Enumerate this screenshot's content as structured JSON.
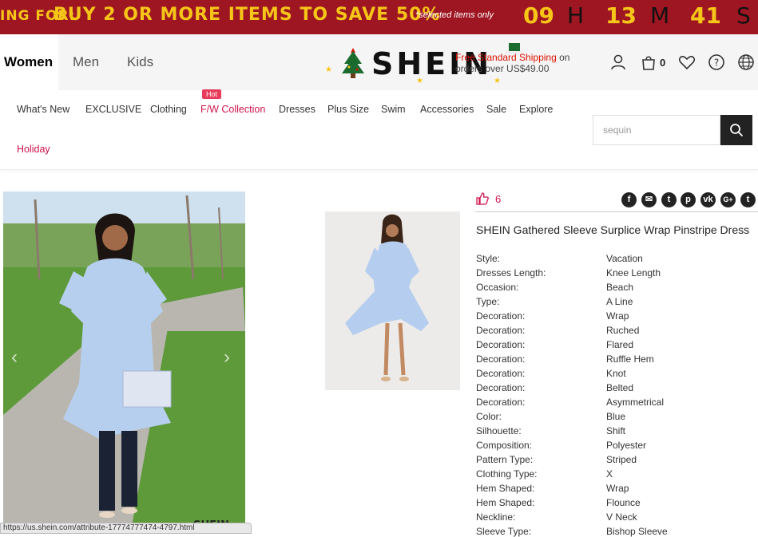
{
  "banner": {
    "lead": "ING FOR:",
    "promo": "BUY 2 OR MORE ITEMS TO SAVE",
    "percent": "50%",
    "note": "*selected items only",
    "hours": "09",
    "hours_unit": "H",
    "minutes": "13",
    "minutes_unit": "M",
    "seconds": "41",
    "seconds_unit": "S",
    "bg_color": "#9e1622",
    "text_color": "#f5c518"
  },
  "header": {
    "tabs": [
      {
        "label": "Women"
      },
      {
        "label": "Men"
      },
      {
        "label": "Kids"
      }
    ],
    "logo": "SHEIN",
    "shipping_highlight": "Free Standard Shipping",
    "shipping_on": "on",
    "shipping_rest": "orders over US$49.00",
    "cart_count": "0",
    "icons": [
      "user-icon",
      "cart-icon",
      "heart-icon",
      "help-icon",
      "globe-icon"
    ]
  },
  "menu": {
    "items": [
      {
        "label": "What's New"
      },
      {
        "label": "EXCLUSIVE"
      },
      {
        "label": "Clothing"
      },
      {
        "label": "F/W Collection"
      },
      {
        "label": "Dresses"
      },
      {
        "label": "Plus Size"
      },
      {
        "label": "Swim"
      },
      {
        "label": "Accessories"
      },
      {
        "label": "Sale"
      },
      {
        "label": "Explore"
      },
      {
        "label": "Holiday"
      }
    ],
    "hot_badge": "Hot",
    "accent_color": "#d1124a"
  },
  "search": {
    "value": "sequin"
  },
  "product": {
    "likes": "6",
    "title": "SHEIN  Gathered Sleeve Surplice Wrap Pinstripe Dress",
    "share_icons": [
      "facebook-icon",
      "messenger-icon",
      "twitter-icon",
      "pinterest-icon",
      "vk-icon",
      "google-plus-icon",
      "tumblr-icon"
    ],
    "attributes": [
      {
        "name": "Style:",
        "value": "Vacation"
      },
      {
        "name": "Dresses Length:",
        "value": "Knee Length"
      },
      {
        "name": "Occasion:",
        "value": "Beach"
      },
      {
        "name": "Type:",
        "value": "A Line"
      },
      {
        "name": "Decoration:",
        "value": "Wrap"
      },
      {
        "name": "Decoration:",
        "value": "Ruched"
      },
      {
        "name": "Decoration:",
        "value": "Flared"
      },
      {
        "name": "Decoration:",
        "value": "Ruffle Hem"
      },
      {
        "name": "Decoration:",
        "value": "Knot"
      },
      {
        "name": "Decoration:",
        "value": "Belted"
      },
      {
        "name": "Decoration:",
        "value": "Asymmetrical"
      },
      {
        "name": "Color:",
        "value": "Blue"
      },
      {
        "name": "Silhouette:",
        "value": "Shift"
      },
      {
        "name": "Composition:",
        "value": "Polyester"
      },
      {
        "name": "Pattern Type:",
        "value": "Striped"
      },
      {
        "name": "Clothing Type:",
        "value": "X"
      },
      {
        "name": "Hem Shaped:",
        "value": "Wrap"
      },
      {
        "name": "Hem Shaped:",
        "value": "Flounce"
      },
      {
        "name": "Neckline:",
        "value": "V Neck"
      },
      {
        "name": "Sleeve Type:",
        "value": "Bishop Sleeve"
      }
    ],
    "photo_watermark": "SHEIN"
  },
  "statusbar": {
    "url": "https://us.shein.com/attribute-17774777474-4797.html"
  }
}
